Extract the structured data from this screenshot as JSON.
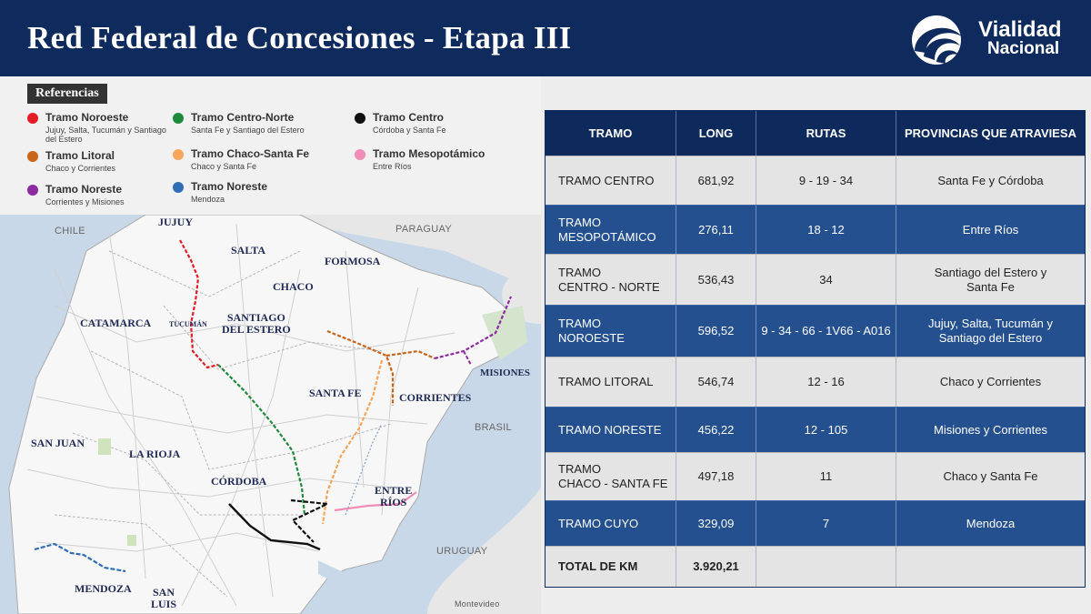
{
  "header": {
    "title": "Red Federal de Concesiones - Etapa III",
    "logo_line1": "Vialidad",
    "logo_line2": "Nacional"
  },
  "legend": {
    "title": "Referencias",
    "items": [
      {
        "name": "Tramo Noroeste",
        "sub": "Jujuy, Salta, Tucumán y Santiago del Estero",
        "color": "#e21d26"
      },
      {
        "name": "Tramo Litoral",
        "sub": "Chaco y Corrientes",
        "color": "#c8651b"
      },
      {
        "name": "Tramo Noreste",
        "sub": "Corrientes y Misiones",
        "color": "#8e2ba3"
      },
      {
        "name": "Tramo Centro-Norte",
        "sub": "Santa Fe y Santiago del Estero",
        "color": "#1e8a3c"
      },
      {
        "name": "Tramo Chaco-Santa Fe",
        "sub": "Chaco y Santa Fe",
        "color": "#f5a65b"
      },
      {
        "name": "Tramo Noreste",
        "sub": "Mendoza",
        "color": "#2f6db5"
      },
      {
        "name": "Tramo Centro",
        "sub": "Córdoba y Santa Fe",
        "color": "#111111"
      },
      {
        "name": "Tramo Mesopotámico",
        "sub": "Entre Ríos",
        "color": "#f08cb8"
      }
    ]
  },
  "map": {
    "provinces": [
      "JUJUY",
      "SALTA",
      "FORMOSA",
      "CHACO",
      "CATAMARCA",
      "TUCUMÁN",
      "SANTIAGO\nDEL ESTERO",
      "SANTA FE",
      "CORRIENTES",
      "MISIONES",
      "SAN JUAN",
      "LA RIOJA",
      "CÓRDOBA",
      "ENTRE\nRÍOS",
      "MENDOZA",
      "SAN\nLUIS"
    ],
    "countries": [
      "CHILE",
      "PARAGUAY",
      "BRASIL",
      "URUGUAY"
    ],
    "city": "Montevideo"
  },
  "table": {
    "headers": [
      "TRAMO",
      "LONG",
      "RUTAS",
      "PROVINCIAS QUE ATRAVIESA"
    ],
    "rows": [
      {
        "tramo": "TRAMO CENTRO",
        "long": "681,92",
        "rutas": "9 - 19 - 34",
        "provincias": "Santa Fe y Córdoba"
      },
      {
        "tramo": "TRAMO\nMESOPOTÁMICO",
        "long": "276,11",
        "rutas": "18 - 12",
        "provincias": "Entre Ríos"
      },
      {
        "tramo": "TRAMO\nCENTRO - NORTE",
        "long": "536,43",
        "rutas": "34",
        "provincias": "Santiago del Estero y\nSanta Fe"
      },
      {
        "tramo": "TRAMO\nNOROESTE",
        "long": "596,52",
        "rutas": "9 - 34 - 66 - 1V66 - A016",
        "provincias": "Jujuy, Salta, Tucumán y\nSantiago del Estero"
      },
      {
        "tramo": "TRAMO LITORAL",
        "long": "546,74",
        "rutas": "12 - 16",
        "provincias": "Chaco y Corrientes"
      },
      {
        "tramo": "TRAMO NORESTE",
        "long": "456,22",
        "rutas": "12 - 105",
        "provincias": "Misiones y Corrientes"
      },
      {
        "tramo": "TRAMO\nCHACO - SANTA FE",
        "long": "497,18",
        "rutas": "11",
        "provincias": "Chaco y Santa Fe"
      },
      {
        "tramo": "TRAMO CUYO",
        "long": "329,09",
        "rutas": "7",
        "provincias": "Mendoza"
      }
    ],
    "total_label": "TOTAL DE KM",
    "total_value": "3.920,21"
  }
}
